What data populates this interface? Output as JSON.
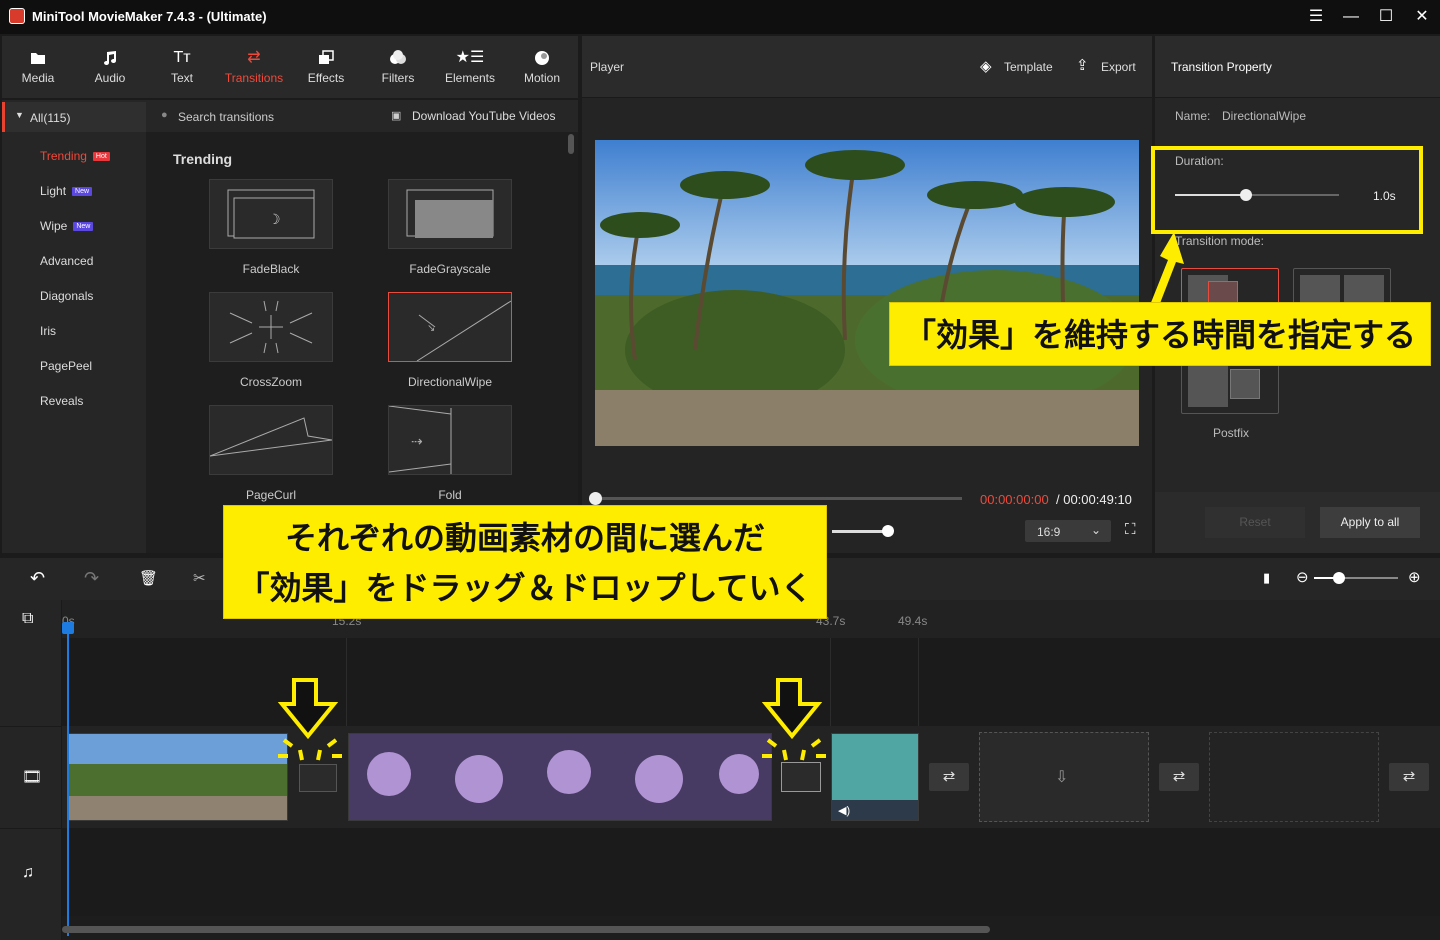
{
  "app": {
    "title": "MiniTool MovieMaker 7.4.3 - (Ultimate)"
  },
  "window_controls": {
    "menu": "☰",
    "minimize": "—",
    "maximize": "☐",
    "close": "✕"
  },
  "toolbar": {
    "items": [
      {
        "label": "Media",
        "icon": "folder-icon"
      },
      {
        "label": "Audio",
        "icon": "music-icon"
      },
      {
        "label": "Text",
        "icon": "text-icon"
      },
      {
        "label": "Transitions",
        "icon": "transitions-icon",
        "active": true
      },
      {
        "label": "Effects",
        "icon": "effects-icon"
      },
      {
        "label": "Filters",
        "icon": "filters-icon"
      },
      {
        "label": "Elements",
        "icon": "elements-icon"
      },
      {
        "label": "Motion",
        "icon": "motion-icon"
      }
    ]
  },
  "categories": {
    "all": "All(115)",
    "items": [
      {
        "label": "Trending",
        "badge": "Hot",
        "active": true
      },
      {
        "label": "Light",
        "badge": "New"
      },
      {
        "label": "Wipe",
        "badge": "New"
      },
      {
        "label": "Advanced"
      },
      {
        "label": "Diagonals"
      },
      {
        "label": "Iris"
      },
      {
        "label": "PagePeel"
      },
      {
        "label": "Reveals"
      }
    ]
  },
  "gallery": {
    "search_placeholder": "Search transitions",
    "download_link": "Download YouTube Videos",
    "section_title": "Trending",
    "tiles": [
      "FadeBlack",
      "FadeGrayscale",
      "CrossZoom",
      "DirectionalWipe",
      "PageCurl",
      "Fold"
    ]
  },
  "player": {
    "title": "Player",
    "template_label": "Template",
    "export_label": "Export",
    "time_current": "00:00:00:00",
    "time_total": " / 00:00:49:10",
    "aspect": "16:9",
    "playhead_progress": 0.0
  },
  "properties": {
    "title": "Transition Property",
    "name_label": "Name:",
    "name_value": "DirectionalWipe",
    "duration_label": "Duration:",
    "duration_value": "1.0s",
    "duration_fraction": 0.43,
    "mode_label": "Transition mode:",
    "postfix_label": "Postfix",
    "reset_label": "Reset",
    "apply_all_label": "Apply to all"
  },
  "timeline": {
    "ruler": [
      "0s",
      "15.2s",
      "43.7s",
      "49.4s"
    ],
    "zoom_fraction": 0.3
  },
  "annotations": {
    "right_callout": "「効果」を維持する時間を指定する",
    "bottom_callout_line1": "それぞれの動画素材の間に選んだ",
    "bottom_callout_line2": "「効果」をドラッグ＆ドロップしていく"
  },
  "colors": {
    "accent": "#f0493a",
    "highlight": "#ffed00",
    "playhead": "#1e7be0"
  }
}
